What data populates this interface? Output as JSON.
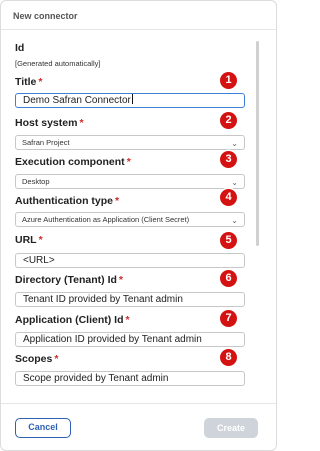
{
  "dialog": {
    "title": "New connector"
  },
  "fields": {
    "id": {
      "label": "Id",
      "value": "[Generated automatically]"
    },
    "title": {
      "label": "Title",
      "value": "Demo Safran Connector",
      "marker": "1"
    },
    "host_system": {
      "label": "Host system",
      "value": "Safran Project",
      "marker": "2"
    },
    "execution_component": {
      "label": "Execution component",
      "value": "Desktop",
      "marker": "3"
    },
    "authentication_type": {
      "label": "Authentication type",
      "value": "Azure Authentication as Application (Client Secret)",
      "marker": "4"
    },
    "url": {
      "label": "URL",
      "value": "<URL>",
      "marker": "5"
    },
    "directory_id": {
      "label": "Directory (Tenant) Id",
      "value": "Tenant ID provided by Tenant admin",
      "marker": "6"
    },
    "application_id": {
      "label": "Application (Client) Id",
      "value": "Application ID provided by Tenant admin",
      "marker": "7"
    },
    "scopes": {
      "label": "Scopes",
      "value": "Scope provided by Tenant admin",
      "marker": "8"
    }
  },
  "required_marker": "*",
  "footer": {
    "cancel_label": "Cancel",
    "create_label": "Create"
  },
  "colors": {
    "accent": "#2f5fb3",
    "required": "#d02b2b",
    "marker": "#d41212",
    "disabled": "#cfd4da"
  }
}
